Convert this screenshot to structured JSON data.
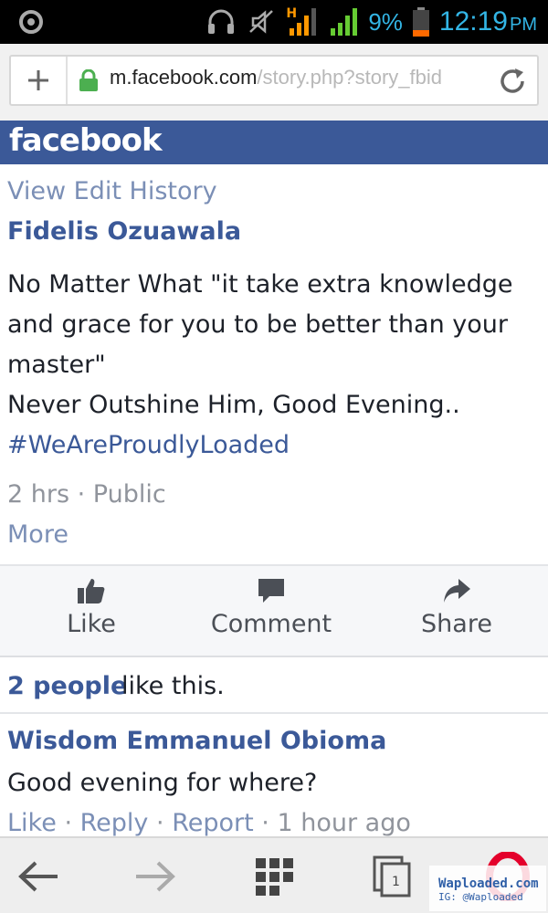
{
  "status_bar": {
    "network_type": "H",
    "battery_percent": "9%",
    "time": "12:19",
    "ampm": "PM",
    "icons": [
      "settings-icon",
      "headset-icon",
      "mute-icon",
      "signal-icon",
      "signal-icon",
      "battery-icon"
    ],
    "accent_color": "#33b5e5"
  },
  "browser": {
    "url_host": "m.facebook.com",
    "url_path": "/story.php?story_fbid",
    "lock_color": "#4caf50"
  },
  "facebook": {
    "logo": "facebook",
    "brand_color": "#3b5998"
  },
  "post": {
    "edit_history": "View Edit History",
    "author": "Fidelis Ozuawala",
    "lines": [
      "No Matter What \"it take extra knowledge",
      "and grace for you to be better than your",
      "master\"",
      "Never Outshine Him, Good Evening.."
    ],
    "hashtag": "#WeAreProudlyLoaded",
    "meta": "2 hrs · Public",
    "more": "More"
  },
  "actions": {
    "like": "Like",
    "comment": "Comment",
    "share": "Share"
  },
  "likes": {
    "count": "2 people",
    "text": "like this."
  },
  "comment": {
    "author": "Wisdom Emmanuel Obioma",
    "text": "Good evening for where?",
    "like": "Like",
    "reply": "Reply",
    "report": "Report",
    "sep": "·",
    "time": "1 hour ago"
  },
  "nav": {
    "tabs_count": "1"
  },
  "watermark": {
    "line1": "Waploaded.com",
    "line2": "IG: @Waploaded"
  }
}
